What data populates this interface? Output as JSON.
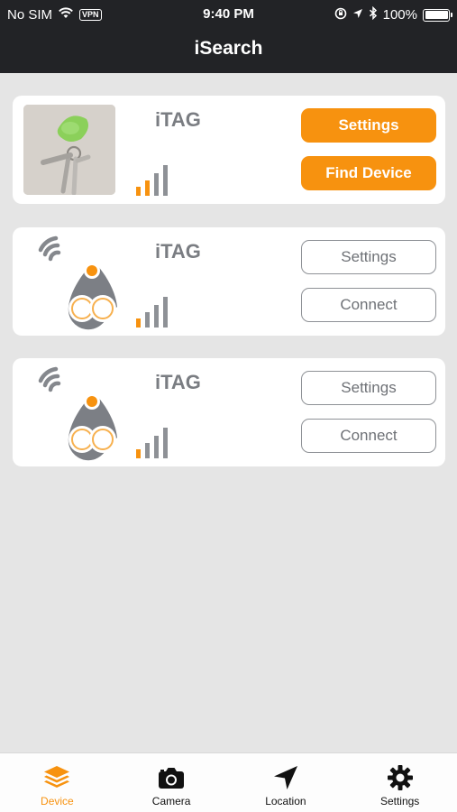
{
  "status_bar": {
    "carrier": "No SIM",
    "vpn": "VPN",
    "time": "9:40 PM",
    "battery": "100%"
  },
  "nav": {
    "title": "iSearch"
  },
  "devices": [
    {
      "name": "iTAG",
      "image": "photo",
      "top_button": "Settings",
      "bottom_button": "Find Device",
      "signal_bars_orange": 2,
      "signal_bars_total": 4
    },
    {
      "name": "iTAG",
      "image": "tag-icon",
      "top_button": "Settings",
      "bottom_button": "Connect",
      "signal_bars_orange": 1,
      "signal_bars_total": 4
    },
    {
      "name": "iTAG",
      "image": "tag-icon",
      "top_button": "Settings",
      "bottom_button": "Connect",
      "signal_bars_orange": 1,
      "signal_bars_total": 4
    }
  ],
  "tabs": [
    {
      "label": "Device",
      "icon": "layers-icon",
      "active": true
    },
    {
      "label": "Camera",
      "icon": "camera-icon",
      "active": false
    },
    {
      "label": "Location",
      "icon": "location-arrow-icon",
      "active": false
    },
    {
      "label": "Settings",
      "icon": "gear-icon",
      "active": false
    }
  ],
  "colors": {
    "accent": "#f7920f",
    "navbar": "#222326",
    "background": "#e5e5e5",
    "muted_gray": "#7a7d82"
  }
}
